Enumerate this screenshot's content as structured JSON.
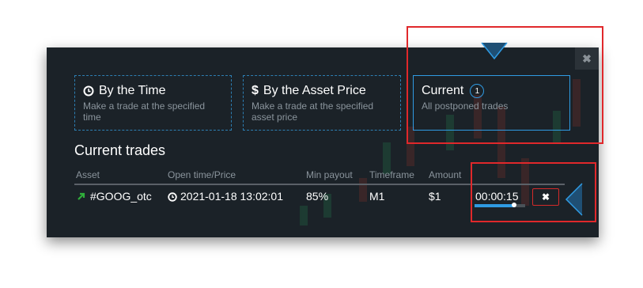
{
  "close_label": "✖",
  "modes": [
    {
      "icon": "clock-icon",
      "title": "By the Time",
      "subtitle": "Make a trade at the specified time"
    },
    {
      "icon": "dollar-icon",
      "title": "By the Asset Price",
      "subtitle": "Make a trade at the specified asset price"
    },
    {
      "icon": "",
      "title": "Current",
      "badge": "1",
      "subtitle": "All postponed trades"
    }
  ],
  "section_title": "Current trades",
  "columns": [
    "Asset",
    "Open time/Price",
    "Min payout",
    "Timeframe",
    "Amount"
  ],
  "trade": {
    "direction": "up",
    "asset": "#GOOG_otc",
    "open_time": "2021-01-18 13:02:01",
    "min_payout": "85%",
    "timeframe": "M1",
    "amount": "$1",
    "countdown": "00:00:15",
    "progress": 0.78,
    "cancel_label": "✖"
  },
  "colors": {
    "panel_bg": "#1b2228",
    "accent_blue": "#2f9be3",
    "up_arrow": "#2fae3a",
    "highlight_red": "#e0282b"
  }
}
